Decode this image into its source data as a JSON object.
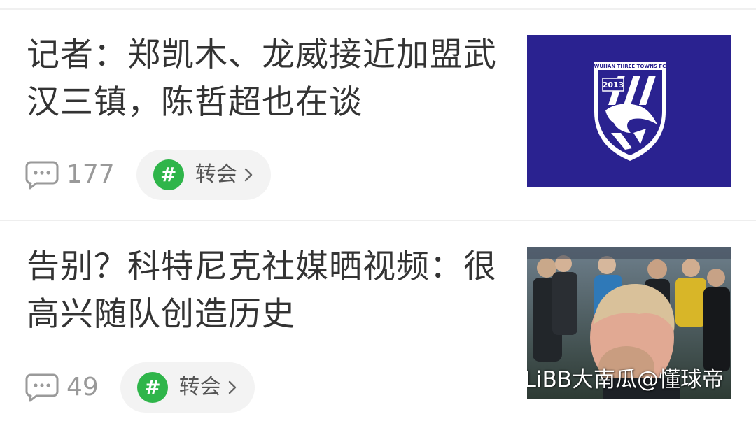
{
  "feed": {
    "items": [
      {
        "title": "记者：郑凯木、龙威接近加盟武汉三镇，陈哲超也在谈",
        "comment_count": "177",
        "tag": {
          "icon": "hash-icon",
          "label": "转会"
        },
        "thumbnail": {
          "description_icon": "wuhan-three-towns-crest",
          "crest_text": "WUHAN THREE TOWNS FC",
          "crest_year": "2013",
          "background": "#2a2290"
        }
      },
      {
        "title": "告别？科特尼克社媒晒视频：很高兴随队创造历史",
        "comment_count": "49",
        "tag": {
          "icon": "hash-icon",
          "label": "转会"
        },
        "thumbnail": {
          "description_icon": "player-photo"
        }
      }
    ]
  },
  "watermark": "LiBB大南瓜@懂球帝",
  "colors": {
    "tag_green": "#2fb54a",
    "text_primary": "#333333",
    "text_secondary": "#999999",
    "pill_bg": "#f3f3f3"
  }
}
